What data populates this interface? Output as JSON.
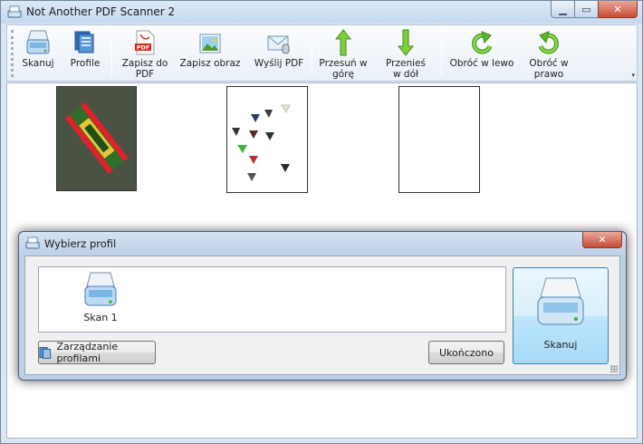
{
  "window": {
    "title": "Not Another PDF Scanner 2",
    "minimize_icon": "minimize-icon",
    "maximize_icon": "maximize-icon",
    "close_icon": "close-icon"
  },
  "toolbar": {
    "items": [
      {
        "label": "Skanuj",
        "icon": "scanner-icon"
      },
      {
        "label": "Profile",
        "icon": "profiles-icon"
      },
      {
        "label": "Zapisz do PDF",
        "icon": "pdf-icon"
      },
      {
        "label": "Zapisz obraz",
        "icon": "image-icon"
      },
      {
        "label": "Wyślij PDF",
        "icon": "email-icon"
      },
      {
        "label": "Przesuń w górę",
        "icon": "arrow-up-icon"
      },
      {
        "label": "Przenieś w dół",
        "icon": "arrow-down-icon"
      },
      {
        "label": "Obróć w lewo",
        "icon": "rotate-left-icon"
      },
      {
        "label": "Obróć w prawo",
        "icon": "rotate-right-icon"
      }
    ]
  },
  "thumbnails": [
    {
      "kind": "scanned-package"
    },
    {
      "kind": "scanned-guitar-picks"
    },
    {
      "kind": "blank-page"
    }
  ],
  "dialog": {
    "title": "Wybierz profil",
    "profiles": [
      {
        "label": "Skan 1",
        "icon": "scanner-icon"
      }
    ],
    "manage_label": "Zarządzanie profilami",
    "done_label": "Ukończono",
    "scan_label": "Skanuj",
    "colors": {
      "accent": "#3c7fb1",
      "close": "#c94a33"
    }
  }
}
